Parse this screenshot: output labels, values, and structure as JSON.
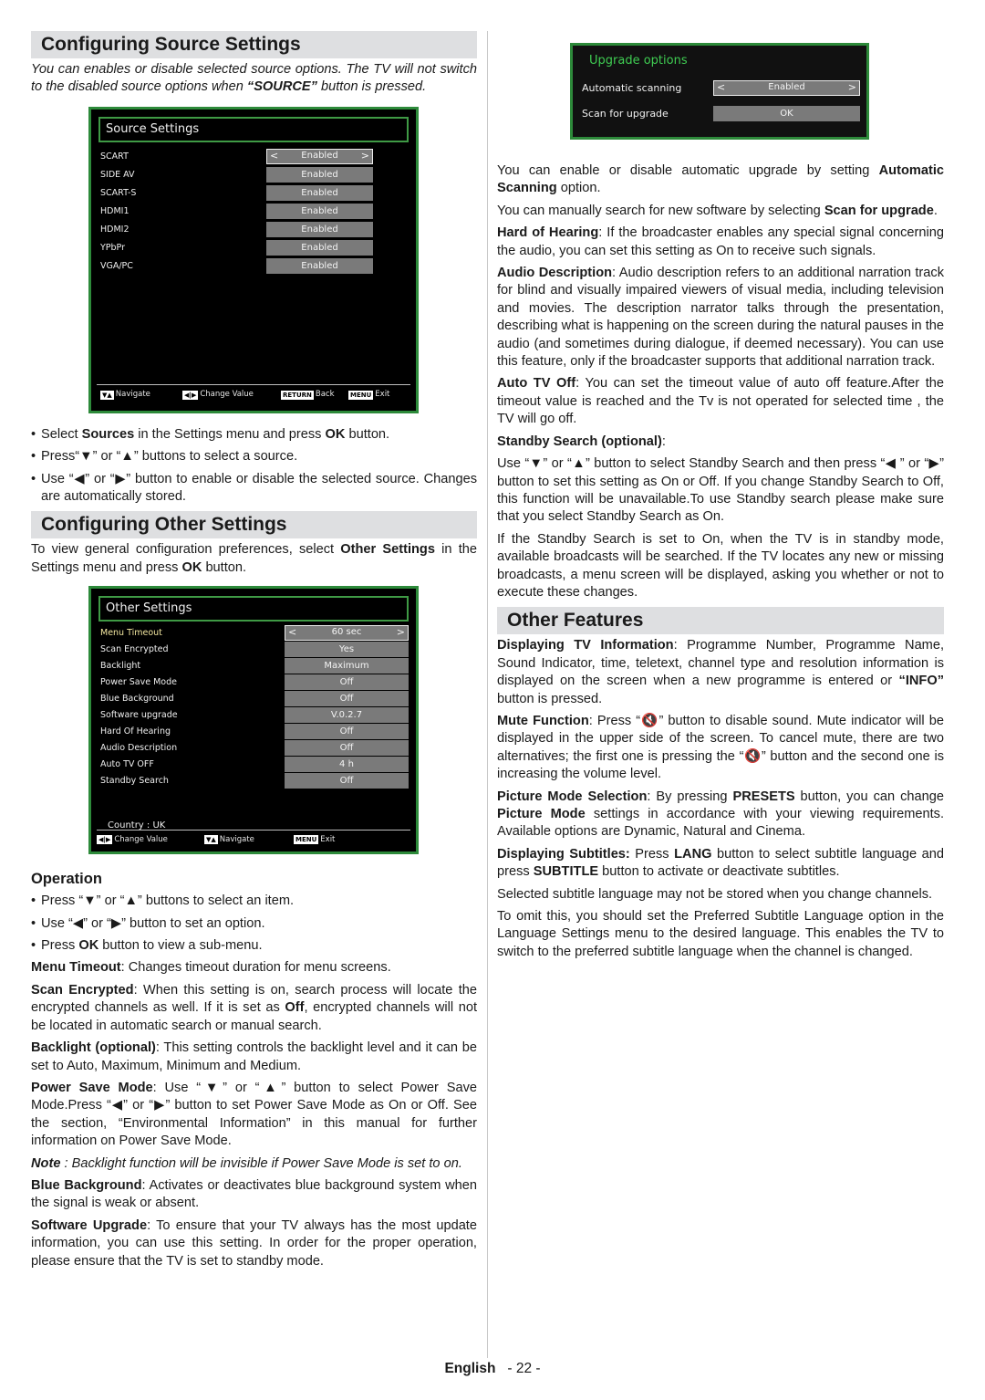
{
  "left": {
    "source_heading": "Configuring Source Settings",
    "source_intro_a": "You can enables or disable selected source options. The TV will not switch to the disabled source options when ",
    "source_intro_b": "“SOURCE”",
    "source_intro_c": " button is pressed.",
    "source_osd": {
      "title": "Source Settings",
      "rows": [
        {
          "label": "SCART",
          "value": "Enabled"
        },
        {
          "label": "SIDE AV",
          "value": "Enabled"
        },
        {
          "label": "SCART-S",
          "value": "Enabled"
        },
        {
          "label": "HDMI1",
          "value": "Enabled"
        },
        {
          "label": "HDMI2",
          "value": "Enabled"
        },
        {
          "label": "YPbPr",
          "value": "Enabled"
        },
        {
          "label": "VGA/PC",
          "value": "Enabled"
        }
      ],
      "footer": {
        "navigate": "Navigate",
        "change": "Change Value",
        "return_key": "RETURN",
        "back": "Back",
        "menu_key": "MENU",
        "exit": "Exit"
      }
    },
    "source_bullets": [
      {
        "a": "Select ",
        "b": "Sources",
        "c": " in the Settings menu and press ",
        "d": "OK",
        "e": " button."
      },
      {
        "a": "Press“▼” or “▲” buttons to select a source."
      },
      {
        "a": "Use “◀” or “▶” button to enable or disable the selected source. Changes are automatically stored."
      }
    ],
    "other_heading": "Configuring Other Settings",
    "other_intro": {
      "a": "To view general configuration preferences, select ",
      "b": "Other Settings",
      "c": " in the Settings menu and press ",
      "d": "OK",
      "e": " button."
    },
    "other_osd": {
      "title": "Other Settings",
      "rows": [
        {
          "label": "Menu Timeout",
          "value": "60 sec"
        },
        {
          "label": "Scan Encrypted",
          "value": "Yes"
        },
        {
          "label": "Backlight",
          "value": "Maximum"
        },
        {
          "label": "Power Save Mode",
          "value": "Off"
        },
        {
          "label": "Blue Background",
          "value": "Off"
        },
        {
          "label": "Software upgrade",
          "value": "V.0.2.7"
        },
        {
          "label": "Hard Of Hearing",
          "value": "Off"
        },
        {
          "label": "Audio Description",
          "value": "Off"
        },
        {
          "label": "Auto TV OFF",
          "value": "4 h"
        },
        {
          "label": "Standby Search",
          "value": "Off"
        }
      ],
      "country": "Country : UK",
      "footer": {
        "change": "Change Value",
        "navigate": "Navigate",
        "menu_key": "MENU",
        "exit": "Exit"
      }
    },
    "operation_heading": "Operation",
    "operation_bullets": [
      {
        "a": "Press “▼” or “▲” buttons to select an item."
      },
      {
        "a": "Use “◀” or “▶” button to set an option."
      },
      {
        "a": "Press ",
        "b": "OK",
        "c": " button to view a sub-menu."
      }
    ],
    "paras": [
      {
        "term": "Menu Timeout",
        "text": ": Changes timeout duration for menu screens."
      },
      {
        "term": "Scan Encrypted",
        "text": ": When this setting is on, search process will locate the encrypted channels as well. If it is set as ",
        "term2": "Off",
        "text2": ", encrypted channels will not be located in automatic search or manual search."
      },
      {
        "term": "Backlight (optional)",
        "text": ": This setting controls the backlight level and it can be set to Auto, Maximum, Minimum and Medium."
      },
      {
        "term": "Power Save Mode",
        "text": ": Use “▼” or “▲” button to select Power Save Mode.Press “◀” or “▶” button to set Power Save Mode as On or Off. See the section, “Environmental Information” in this manual for further information on Power Save Mode."
      },
      {
        "term": "Note",
        "text": " : Backlight function will be invisible if Power Save Mode is set to on."
      },
      {
        "term": "Blue Background",
        "text": ": Activates or deactivates blue background system when the signal is weak or absent."
      },
      {
        "term": "Software Upgrade",
        "text": ": To ensure that your TV always has the most update information, you can use this setting. In order for the proper operation, please ensure that the TV is set to standby mode."
      }
    ]
  },
  "right": {
    "upgrade_osd": {
      "title": "Upgrade options",
      "rows": [
        {
          "label": "Automatic scanning",
          "value": "Enabled"
        },
        {
          "label": "Scan for upgrade",
          "value": "OK"
        }
      ]
    },
    "p1": {
      "a": "You can enable or disable automatic upgrade by setting ",
      "b": "Automatic Scanning",
      "c": " option."
    },
    "p2": {
      "a": "You can manually search for new software by selecting ",
      "b": "Scan for upgrade",
      "c": "."
    },
    "p3": {
      "term": "Hard of Hearing",
      "text": ": If the broadcaster enables any special signal concerning the audio, you can set this setting as On to receive such signals."
    },
    "p4": {
      "term": "Audio Description",
      "text": ": Audio description refers to an additional narration track for blind and visually impaired viewers of visual media, including television and movies. The description narrator talks through the presentation, describing what is happening on the screen during the natural pauses in the audio (and sometimes during dialogue, if deemed necessary). You can use this feature, only if the broadcaster supports that additional narration track."
    },
    "p5": {
      "term": "Auto TV Off",
      "text": ": You can set the timeout value of auto off feature.After the timeout value is reached and the Tv is not operated for selected time , the TV will go off."
    },
    "p6": {
      "term": "Standby Search (optional)",
      "text": ":"
    },
    "p7": "Use “▼” or “▲” button to select Standby Search and then press “◀ ” or “▶” button to set this setting as On or Off. If you change Standby Search to Off, this function will be unavailable.To use Standby search please make sure that you select Standby Search as On.",
    "p8": "If the Standby Search is set to On, when the TV is in standby mode, available broadcasts will be searched. If the TV locates any new or missing broadcasts, a menu screen will be displayed, asking you whether or not to execute these changes.",
    "features_heading": "Other Features",
    "f1": {
      "term": "Displaying TV Information",
      "text": ": Programme Number, Programme Name, Sound Indicator, time, teletext,  channel type and resolution information is displayed on the screen when a new programme is entered or ",
      "term2": "“INFO”",
      "text2": " button is pressed."
    },
    "f2": {
      "term": "Mute Function",
      "text_a": ": Press “",
      "text_b": "” button to disable sound. Mute indicator will be displayed in the upper side of the screen. To cancel mute, there are two alternatives; the first one is pressing the “",
      "text_c": "” button and the second one is increasing the volume level."
    },
    "f3": {
      "term": "Picture Mode Selection",
      "a": ": By pressing ",
      "b": "PRESETS",
      "c": " button, you can change ",
      "d": "Picture Mode",
      "e": " settings in accordance with your viewing requirements. Available options are Dynamic, Natural and Cinema."
    },
    "f4": {
      "term": "Displaying Subtitles:",
      "a": " Press ",
      "b": "LANG",
      "c": " button to select subtitle language and press ",
      "d": "SUBTITLE",
      "e": " button to activate or deactivate subtitles."
    },
    "f5": "Selected subtitle language may not be stored when you change channels.",
    "f6": "To omit this, you should set the Preferred Subtitle Language option in the Language Settings menu to the desired language. This enables the TV to switch to the preferred subtitle language when the channel is changed."
  },
  "footer": {
    "language": "English",
    "page": "- 22 -"
  }
}
